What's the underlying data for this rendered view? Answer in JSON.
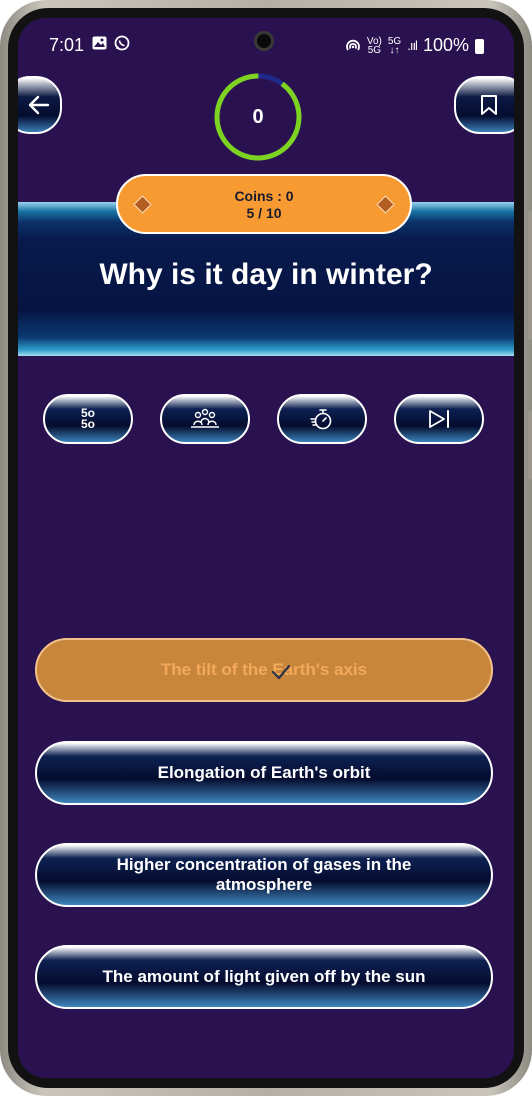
{
  "status_bar": {
    "time": "7:01",
    "left_icons": [
      "gallery-icon",
      "whatsapp-icon"
    ],
    "net_top": "Vo)",
    "net_bottom": "5G",
    "net2_top": "5G",
    "net2_bottom": "↓↑",
    "battery": "100%"
  },
  "header": {
    "timer_value": "0",
    "timer_progress": 0.1
  },
  "coins": {
    "label": "Coins : 0",
    "progress": "5 / 10"
  },
  "question": {
    "text": "Why is it day in winter?"
  },
  "lifelines": [
    {
      "name": "fifty-fifty",
      "label_top": "5o",
      "label_bottom": "5o"
    },
    {
      "name": "audience-poll"
    },
    {
      "name": "time-freeze"
    },
    {
      "name": "skip"
    }
  ],
  "answers": [
    {
      "text": "The tilt of the Earth's axis",
      "selected": true
    },
    {
      "text": "Elongation of Earth's orbit",
      "selected": false
    },
    {
      "text": "Higher concentration of gases in the atmosphere",
      "selected": false
    },
    {
      "text": "The amount of light given off by the sun",
      "selected": false
    }
  ],
  "colors": {
    "background": "#2a1150",
    "accent": "#f79a32",
    "selected_answer": "#c8863d",
    "timer_ring": "#7ed321",
    "timer_ring_track": "#1f2a8a"
  }
}
